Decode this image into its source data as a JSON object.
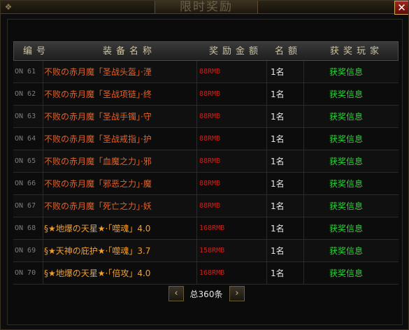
{
  "window": {
    "title": "限时奖励",
    "close_glyph": "✕"
  },
  "table": {
    "headers": [
      "编号",
      "装备名称",
      "奖励金额",
      "名额",
      "获奖玩家"
    ],
    "rows": [
      {
        "no": "ON 61",
        "name": "不败の赤月魔「圣战头盔」·湮",
        "name_color": "#e2622a",
        "prize": "88RMB",
        "qty": "1名",
        "winner": "获奖信息"
      },
      {
        "no": "ON 62",
        "name": "不败の赤月魔「圣战项链」·终",
        "name_color": "#e2622a",
        "prize": "88RMB",
        "qty": "1名",
        "winner": "获奖信息"
      },
      {
        "no": "ON 63",
        "name": "不败の赤月魔「圣战手镯」·守",
        "name_color": "#e2622a",
        "prize": "88RMB",
        "qty": "1名",
        "winner": "获奖信息"
      },
      {
        "no": "ON 64",
        "name": "不败の赤月魔「圣战戒指」·护",
        "name_color": "#e2622a",
        "prize": "88RMB",
        "qty": "1名",
        "winner": "获奖信息"
      },
      {
        "no": "ON 65",
        "name": "不败の赤月魔「血魔之力」·邪",
        "name_color": "#e2622a",
        "prize": "88RMB",
        "qty": "1名",
        "winner": "获奖信息"
      },
      {
        "no": "ON 66",
        "name": "不败の赤月魔「邪恶之力」·魔",
        "name_color": "#e2622a",
        "prize": "88RMB",
        "qty": "1名",
        "winner": "获奖信息"
      },
      {
        "no": "ON 67",
        "name": "不败の赤月魔「死亡之力」·妖",
        "name_color": "#e2622a",
        "prize": "88RMB",
        "qty": "1名",
        "winner": "获奖信息"
      },
      {
        "no": "ON 68",
        "name": "§★地爆の天星★·「噬魂」4.0",
        "name_color": "#f0a030",
        "prize": "168RMB",
        "qty": "1名",
        "winner": "获奖信息"
      },
      {
        "no": "ON 69",
        "name": "§★天神の庇护★·「噬魂」3.7",
        "name_color": "#f0a030",
        "prize": "158RMB",
        "qty": "1名",
        "winner": "获奖信息"
      },
      {
        "no": "ON 70",
        "name": "§★地爆の天星★·「倍攻」4.0",
        "name_color": "#f0a030",
        "prize": "168RMB",
        "qty": "1名",
        "winner": "获奖信息"
      }
    ]
  },
  "pager": {
    "prev_glyph": "‹",
    "next_glyph": "›",
    "total": "总360条"
  },
  "colors": {
    "equip_name_normal": "#e2622a",
    "equip_name_special": "#f0a030",
    "prize": "#c3241c",
    "winner_link": "#32d23c",
    "header_text": "#cfc39b"
  }
}
